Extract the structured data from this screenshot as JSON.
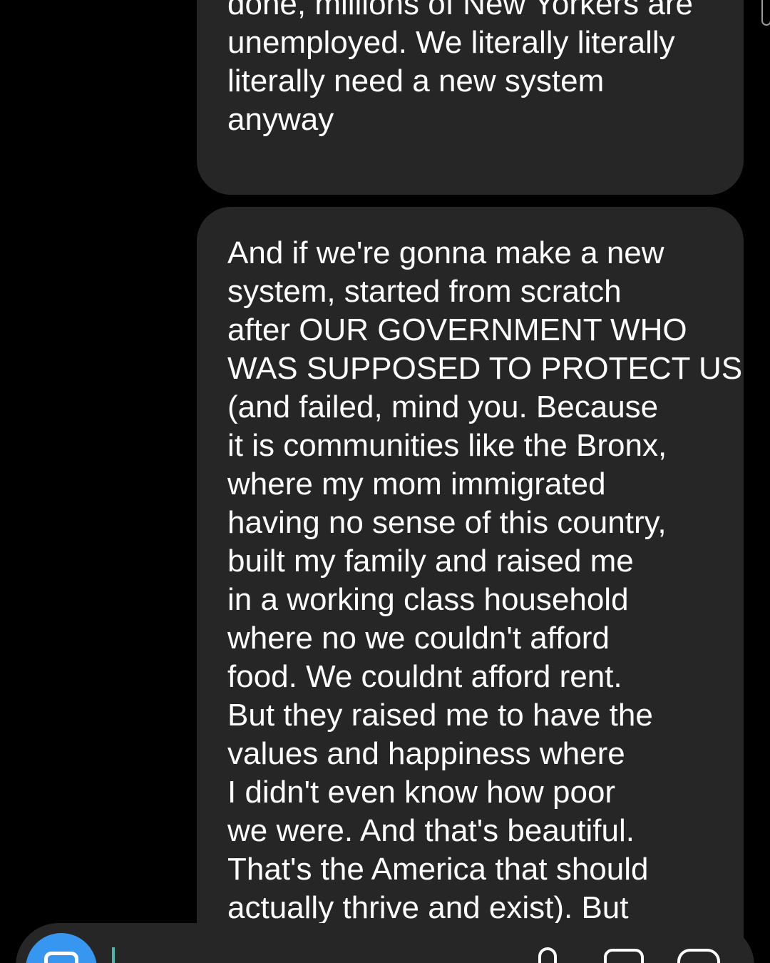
{
  "thread": {
    "messages": [
      {
        "lines": [
          "done, millions of New Yorkers are",
          "unemployed. We literally literally",
          "literally need a new system",
          "anyway"
        ]
      },
      {
        "lines": [
          "And if we're gonna make a new",
          "system, started from scratch",
          "after OUR GOVERNMENT WHO",
          "WAS SUPPOSED TO PROTECT US",
          "(and failed, mind you. Because",
          "it is communities like the Bronx,",
          "where my mom immigrated",
          "having no sense of this country,",
          "built my family and raised me",
          "in a working class household",
          "where no we couldn't afford",
          "food. We couldnt afford rent.",
          "But they raised me to have the",
          "values and happiness where",
          "I didn't even know how poor",
          "we were. And that's beautiful.",
          "That's the America that should",
          "actually thrive and exist). But"
        ]
      }
    ]
  },
  "composer": {
    "camera_icon": "camera-icon",
    "mic_icon": "microphone-icon",
    "gallery_icon": "gallery-icon",
    "sticker_icon": "sticker-icon",
    "accent_color": "#3797f0",
    "cursor_color": "#4db6ac"
  },
  "colors": {
    "background": "#000000",
    "bubble": "#262626",
    "text": "#ffffff"
  }
}
